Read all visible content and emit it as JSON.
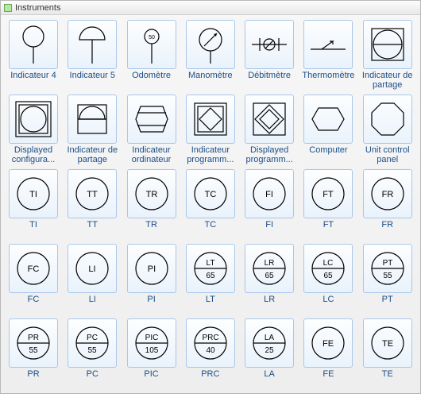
{
  "panel": {
    "title": "Instruments"
  },
  "items": [
    {
      "id": "indicateur-4",
      "label": "Indicateur 4",
      "shape": "balloon-circle"
    },
    {
      "id": "indicateur-5",
      "label": "Indicateur 5",
      "shape": "balloon-dome"
    },
    {
      "id": "odometre",
      "label": "Odomètre",
      "shape": "odometer",
      "val": "50"
    },
    {
      "id": "manometre",
      "label": "Manomètre",
      "shape": "gauge"
    },
    {
      "id": "debitmetre",
      "label": "Débitmètre",
      "shape": "flowmeter"
    },
    {
      "id": "thermometre",
      "label": "Thermomètre",
      "shape": "thermo"
    },
    {
      "id": "ind-partage",
      "label": "Indicateur de partage",
      "shape": "shared-circle"
    },
    {
      "id": "disp-config",
      "label": "Displayed configura...",
      "shape": "boxed-circle"
    },
    {
      "id": "ind-partage2",
      "label": "Indicateur de partage",
      "shape": "shared-half"
    },
    {
      "id": "ind-ordi",
      "label": "Indicateur ordinateur",
      "shape": "hex-strip"
    },
    {
      "id": "ind-prog",
      "label": "Indicateur programm...",
      "shape": "boxed-diamond"
    },
    {
      "id": "disp-prog",
      "label": "Displayed programm...",
      "shape": "double-diamond"
    },
    {
      "id": "computer",
      "label": "Computer",
      "shape": "hexagon"
    },
    {
      "id": "ucp",
      "label": "Unit control panel",
      "shape": "octagon"
    },
    {
      "id": "ti",
      "label": "TI",
      "shape": "circ-text",
      "top": "TI"
    },
    {
      "id": "tt",
      "label": "TT",
      "shape": "circ-text",
      "top": "TT"
    },
    {
      "id": "tr",
      "label": "TR",
      "shape": "circ-text",
      "top": "TR"
    },
    {
      "id": "tc",
      "label": "TC",
      "shape": "circ-text",
      "top": "TC"
    },
    {
      "id": "fi",
      "label": "FI",
      "shape": "circ-text",
      "top": "FI"
    },
    {
      "id": "ft",
      "label": "FT",
      "shape": "circ-text",
      "top": "FT"
    },
    {
      "id": "fr",
      "label": "FR",
      "shape": "circ-text",
      "top": "FR"
    },
    {
      "id": "fc",
      "label": "FC",
      "shape": "circ-text",
      "top": "FC"
    },
    {
      "id": "li",
      "label": "LI",
      "shape": "circ-text",
      "top": "LI"
    },
    {
      "id": "pi",
      "label": "PI",
      "shape": "circ-text",
      "top": "PI"
    },
    {
      "id": "lt",
      "label": "LT",
      "shape": "circ-split",
      "top": "LT",
      "bot": "65"
    },
    {
      "id": "lr",
      "label": "LR",
      "shape": "circ-split",
      "top": "LR",
      "bot": "65"
    },
    {
      "id": "lc",
      "label": "LC",
      "shape": "circ-split",
      "top": "LC",
      "bot": "65"
    },
    {
      "id": "pt",
      "label": "PT",
      "shape": "circ-split",
      "top": "PT",
      "bot": "55"
    },
    {
      "id": "pr",
      "label": "PR",
      "shape": "circ-split",
      "top": "PR",
      "bot": "55"
    },
    {
      "id": "pc",
      "label": "PC",
      "shape": "circ-split",
      "top": "PC",
      "bot": "55"
    },
    {
      "id": "pic",
      "label": "PIC",
      "shape": "circ-split",
      "top": "PIC",
      "bot": "105"
    },
    {
      "id": "prc",
      "label": "PRC",
      "shape": "circ-split",
      "top": "PRC",
      "bot": "40"
    },
    {
      "id": "la",
      "label": "LA",
      "shape": "circ-split",
      "top": "LA",
      "bot": "25"
    },
    {
      "id": "fe",
      "label": "FE",
      "shape": "circ-text",
      "top": "FE"
    },
    {
      "id": "te",
      "label": "TE",
      "shape": "circ-text",
      "top": "TE"
    }
  ]
}
